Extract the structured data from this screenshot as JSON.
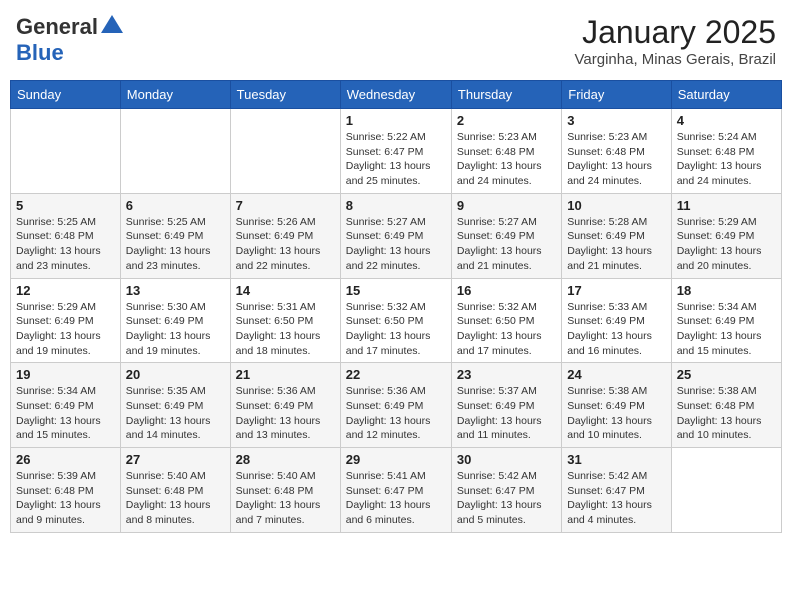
{
  "header": {
    "logo_general": "General",
    "logo_blue": "Blue",
    "month": "January 2025",
    "location": "Varginha, Minas Gerais, Brazil"
  },
  "weekdays": [
    "Sunday",
    "Monday",
    "Tuesday",
    "Wednesday",
    "Thursday",
    "Friday",
    "Saturday"
  ],
  "weeks": [
    [
      {
        "day": "",
        "sunrise": "",
        "sunset": "",
        "daylight": ""
      },
      {
        "day": "",
        "sunrise": "",
        "sunset": "",
        "daylight": ""
      },
      {
        "day": "",
        "sunrise": "",
        "sunset": "",
        "daylight": ""
      },
      {
        "day": "1",
        "sunrise": "Sunrise: 5:22 AM",
        "sunset": "Sunset: 6:47 PM",
        "daylight": "Daylight: 13 hours and 25 minutes."
      },
      {
        "day": "2",
        "sunrise": "Sunrise: 5:23 AM",
        "sunset": "Sunset: 6:48 PM",
        "daylight": "Daylight: 13 hours and 24 minutes."
      },
      {
        "day": "3",
        "sunrise": "Sunrise: 5:23 AM",
        "sunset": "Sunset: 6:48 PM",
        "daylight": "Daylight: 13 hours and 24 minutes."
      },
      {
        "day": "4",
        "sunrise": "Sunrise: 5:24 AM",
        "sunset": "Sunset: 6:48 PM",
        "daylight": "Daylight: 13 hours and 24 minutes."
      }
    ],
    [
      {
        "day": "5",
        "sunrise": "Sunrise: 5:25 AM",
        "sunset": "Sunset: 6:48 PM",
        "daylight": "Daylight: 13 hours and 23 minutes."
      },
      {
        "day": "6",
        "sunrise": "Sunrise: 5:25 AM",
        "sunset": "Sunset: 6:49 PM",
        "daylight": "Daylight: 13 hours and 23 minutes."
      },
      {
        "day": "7",
        "sunrise": "Sunrise: 5:26 AM",
        "sunset": "Sunset: 6:49 PM",
        "daylight": "Daylight: 13 hours and 22 minutes."
      },
      {
        "day": "8",
        "sunrise": "Sunrise: 5:27 AM",
        "sunset": "Sunset: 6:49 PM",
        "daylight": "Daylight: 13 hours and 22 minutes."
      },
      {
        "day": "9",
        "sunrise": "Sunrise: 5:27 AM",
        "sunset": "Sunset: 6:49 PM",
        "daylight": "Daylight: 13 hours and 21 minutes."
      },
      {
        "day": "10",
        "sunrise": "Sunrise: 5:28 AM",
        "sunset": "Sunset: 6:49 PM",
        "daylight": "Daylight: 13 hours and 21 minutes."
      },
      {
        "day": "11",
        "sunrise": "Sunrise: 5:29 AM",
        "sunset": "Sunset: 6:49 PM",
        "daylight": "Daylight: 13 hours and 20 minutes."
      }
    ],
    [
      {
        "day": "12",
        "sunrise": "Sunrise: 5:29 AM",
        "sunset": "Sunset: 6:49 PM",
        "daylight": "Daylight: 13 hours and 19 minutes."
      },
      {
        "day": "13",
        "sunrise": "Sunrise: 5:30 AM",
        "sunset": "Sunset: 6:49 PM",
        "daylight": "Daylight: 13 hours and 19 minutes."
      },
      {
        "day": "14",
        "sunrise": "Sunrise: 5:31 AM",
        "sunset": "Sunset: 6:50 PM",
        "daylight": "Daylight: 13 hours and 18 minutes."
      },
      {
        "day": "15",
        "sunrise": "Sunrise: 5:32 AM",
        "sunset": "Sunset: 6:50 PM",
        "daylight": "Daylight: 13 hours and 17 minutes."
      },
      {
        "day": "16",
        "sunrise": "Sunrise: 5:32 AM",
        "sunset": "Sunset: 6:50 PM",
        "daylight": "Daylight: 13 hours and 17 minutes."
      },
      {
        "day": "17",
        "sunrise": "Sunrise: 5:33 AM",
        "sunset": "Sunset: 6:49 PM",
        "daylight": "Daylight: 13 hours and 16 minutes."
      },
      {
        "day": "18",
        "sunrise": "Sunrise: 5:34 AM",
        "sunset": "Sunset: 6:49 PM",
        "daylight": "Daylight: 13 hours and 15 minutes."
      }
    ],
    [
      {
        "day": "19",
        "sunrise": "Sunrise: 5:34 AM",
        "sunset": "Sunset: 6:49 PM",
        "daylight": "Daylight: 13 hours and 15 minutes."
      },
      {
        "day": "20",
        "sunrise": "Sunrise: 5:35 AM",
        "sunset": "Sunset: 6:49 PM",
        "daylight": "Daylight: 13 hours and 14 minutes."
      },
      {
        "day": "21",
        "sunrise": "Sunrise: 5:36 AM",
        "sunset": "Sunset: 6:49 PM",
        "daylight": "Daylight: 13 hours and 13 minutes."
      },
      {
        "day": "22",
        "sunrise": "Sunrise: 5:36 AM",
        "sunset": "Sunset: 6:49 PM",
        "daylight": "Daylight: 13 hours and 12 minutes."
      },
      {
        "day": "23",
        "sunrise": "Sunrise: 5:37 AM",
        "sunset": "Sunset: 6:49 PM",
        "daylight": "Daylight: 13 hours and 11 minutes."
      },
      {
        "day": "24",
        "sunrise": "Sunrise: 5:38 AM",
        "sunset": "Sunset: 6:49 PM",
        "daylight": "Daylight: 13 hours and 10 minutes."
      },
      {
        "day": "25",
        "sunrise": "Sunrise: 5:38 AM",
        "sunset": "Sunset: 6:48 PM",
        "daylight": "Daylight: 13 hours and 10 minutes."
      }
    ],
    [
      {
        "day": "26",
        "sunrise": "Sunrise: 5:39 AM",
        "sunset": "Sunset: 6:48 PM",
        "daylight": "Daylight: 13 hours and 9 minutes."
      },
      {
        "day": "27",
        "sunrise": "Sunrise: 5:40 AM",
        "sunset": "Sunset: 6:48 PM",
        "daylight": "Daylight: 13 hours and 8 minutes."
      },
      {
        "day": "28",
        "sunrise": "Sunrise: 5:40 AM",
        "sunset": "Sunset: 6:48 PM",
        "daylight": "Daylight: 13 hours and 7 minutes."
      },
      {
        "day": "29",
        "sunrise": "Sunrise: 5:41 AM",
        "sunset": "Sunset: 6:47 PM",
        "daylight": "Daylight: 13 hours and 6 minutes."
      },
      {
        "day": "30",
        "sunrise": "Sunrise: 5:42 AM",
        "sunset": "Sunset: 6:47 PM",
        "daylight": "Daylight: 13 hours and 5 minutes."
      },
      {
        "day": "31",
        "sunrise": "Sunrise: 5:42 AM",
        "sunset": "Sunset: 6:47 PM",
        "daylight": "Daylight: 13 hours and 4 minutes."
      },
      {
        "day": "",
        "sunrise": "",
        "sunset": "",
        "daylight": ""
      }
    ]
  ]
}
